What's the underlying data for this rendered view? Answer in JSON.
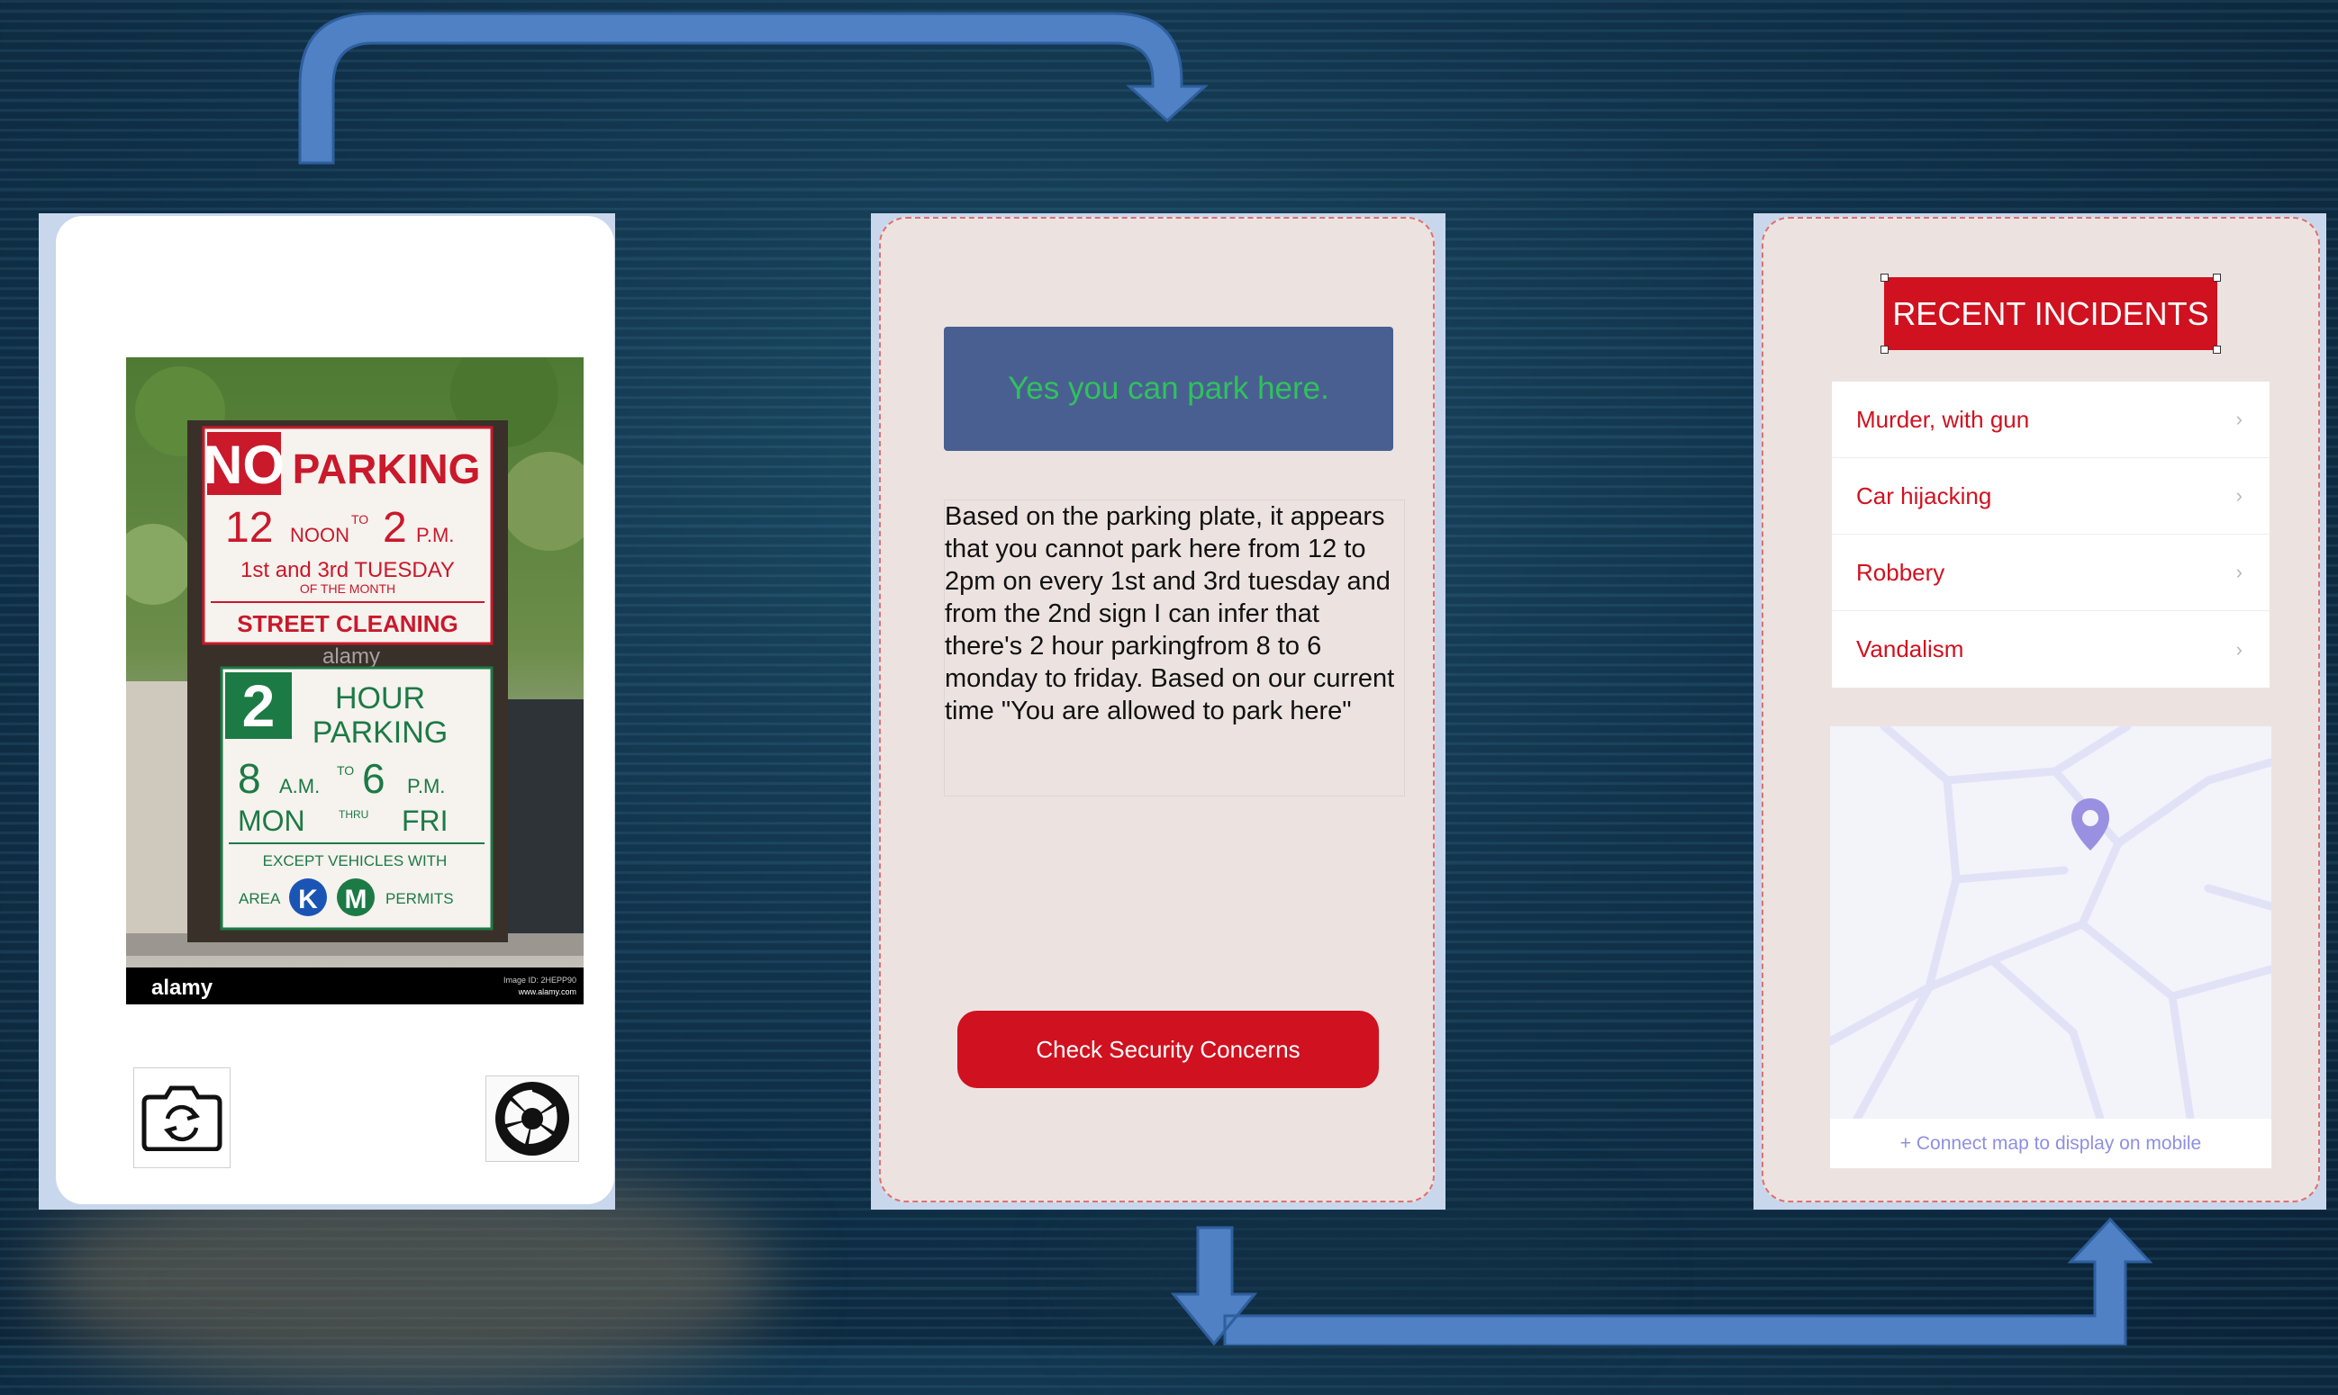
{
  "screen1": {
    "icons": {
      "camera_switch": "camera-switch-icon",
      "shutter": "shutter-icon"
    },
    "photo": {
      "sign1": {
        "no": "NO",
        "parking": "PARKING",
        "time_start": "12",
        "noon": "NOON",
        "to": "TO",
        "time_end": "2",
        "pm": "P.M.",
        "days": "1st and 3rd TUESDAY",
        "of_month": "OF THE MONTH",
        "street_cleaning": "STREET CLEANING"
      },
      "sign2": {
        "number": "2",
        "hour": "HOUR",
        "parking": "PARKING",
        "from": "8",
        "am": "A.M.",
        "to": "TO",
        "until": "6",
        "pm": "P.M.",
        "mon": "MON",
        "thru": "THRU",
        "fri": "FRI",
        "except": "EXCEPT VEHICLES WITH",
        "area": "AREA",
        "k": "K",
        "m": "M",
        "permits": "PERMITS"
      },
      "watermark_brand": "alamy",
      "watermark_url": "www.alamy.com",
      "image_id": "Image ID: 2HEPP90"
    }
  },
  "screen2": {
    "answer": "Yes you can park here.",
    "explanation": "Based on the parking plate, it appears that you cannot park here from 12 to 2pm on every 1st and 3rd tuesday and from the 2nd sign I can infer that there's 2 hour parkingfrom 8 to 6 monday to friday. Based on our current time \"You are allowed to park here\"",
    "button": "Check Security Concerns",
    "colors": {
      "answer_bg": "#4a5f91",
      "answer_text": "#2fc25c",
      "button_bg": "#d0111f"
    }
  },
  "screen3": {
    "title": "RECENT INCIDENTS",
    "incidents": [
      {
        "label": "Murder, with gun"
      },
      {
        "label": "Car hijacking"
      },
      {
        "label": "Robbery"
      },
      {
        "label": "Vandalism"
      }
    ],
    "chevron": "›",
    "map": {
      "pin": "map-pin-icon",
      "caption": "+ Connect map to display on mobile"
    },
    "colors": {
      "accent": "#d0111f",
      "map_link": "#8f8fe0"
    }
  }
}
